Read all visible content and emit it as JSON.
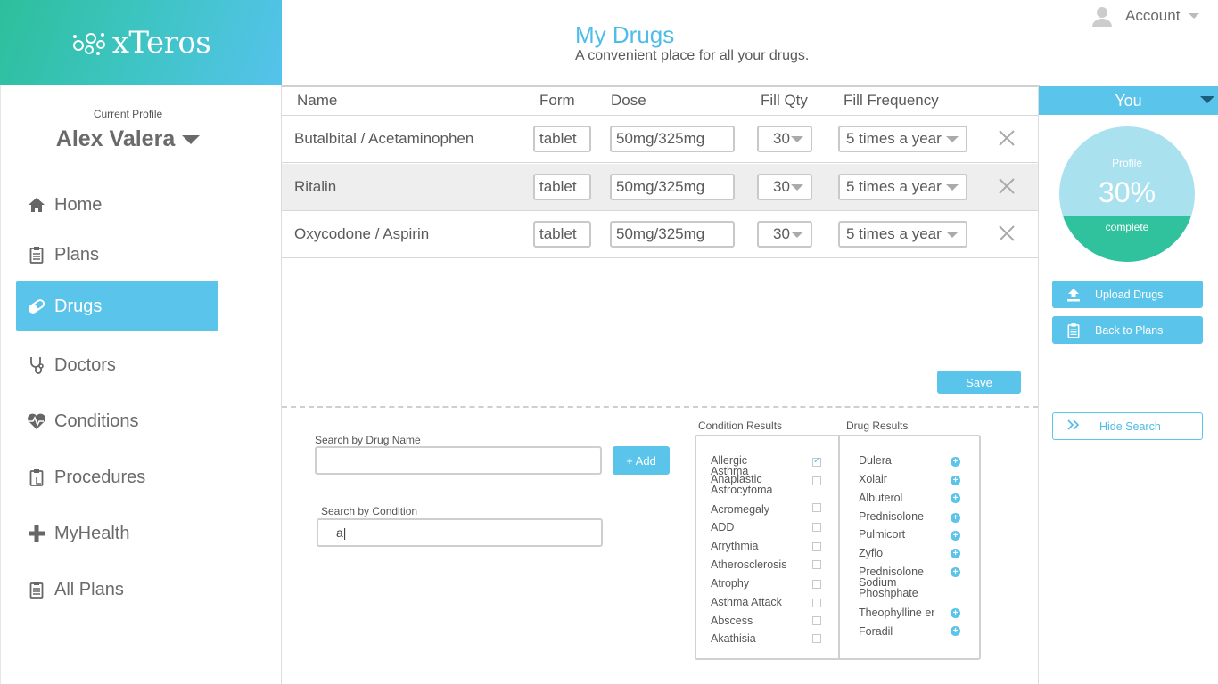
{
  "brand": {
    "name": "xTeros"
  },
  "header": {
    "title": "My Drugs",
    "subtitle": "A convenient place for all your drugs.",
    "account_label": "Account"
  },
  "sidebar": {
    "profile_caption": "Current Profile",
    "profile_name": "Alex Valera",
    "items": [
      {
        "label": "Home",
        "icon": "home-icon"
      },
      {
        "label": "Plans",
        "icon": "clipboard-icon"
      },
      {
        "label": "Drugs",
        "icon": "pill-icon",
        "active": true
      },
      {
        "label": "Doctors",
        "icon": "stethoscope-icon"
      },
      {
        "label": "Conditions",
        "icon": "heartbeat-icon"
      },
      {
        "label": "Procedures",
        "icon": "clipboard-icon"
      },
      {
        "label": "MyHealth",
        "icon": "plus-icon"
      },
      {
        "label": "All Plans",
        "icon": "clipboard-icon"
      }
    ]
  },
  "table": {
    "columns": [
      "Name",
      "Form",
      "Dose",
      "Fill Qty",
      "Fill Frequency"
    ],
    "rows": [
      {
        "name": "Butalbital / Acetaminophen",
        "form": "tablet",
        "dose": "50mg/325mg",
        "qty": "30",
        "freq": "5 times a year"
      },
      {
        "name": "Ritalin",
        "form": "tablet",
        "dose": "50mg/325mg",
        "qty": "30",
        "freq": "5 times a year"
      },
      {
        "name": "Oxycodone / Aspirin",
        "form": "tablet",
        "dose": "50mg/325mg",
        "qty": "30",
        "freq": "5 times a year"
      }
    ],
    "save_label": "Save"
  },
  "search": {
    "drug_label": "Search by Drug Name",
    "drug_value": "",
    "add_label": "+ Add",
    "condition_label": "Search by Condition",
    "condition_value": "a|"
  },
  "results": {
    "condition_header": "Condition Results",
    "drug_header": "Drug Results",
    "conditions": [
      {
        "label": "Allergic Asthma",
        "checked": true
      },
      {
        "label": "Anaplastic Astrocytoma",
        "checked": false
      },
      {
        "label": "Acromegaly",
        "checked": false
      },
      {
        "label": "ADD",
        "checked": false
      },
      {
        "label": "Arrythmia",
        "checked": false
      },
      {
        "label": "Atherosclerosis",
        "checked": false
      },
      {
        "label": "Atrophy",
        "checked": false
      },
      {
        "label": "Asthma Attack",
        "checked": false
      },
      {
        "label": "Abscess",
        "checked": false
      },
      {
        "label": "Akathisia",
        "checked": false
      }
    ],
    "drugs": [
      "Dulera",
      "Xolair",
      "Albuterol",
      "Prednisolone",
      "Pulmicort",
      "Zyflo",
      "Prednisolone Sodium Phoshphate",
      "Theophylline er",
      "Foradil"
    ]
  },
  "right": {
    "you_label": "You",
    "profile_label": "Profile",
    "percent": "30%",
    "complete_label": "complete",
    "upload_label": "Upload Drugs",
    "back_label": "Back to Plans",
    "hide_label": "Hide Search"
  },
  "colors": {
    "accent": "#5bc4ea",
    "green": "#2fc29c"
  }
}
